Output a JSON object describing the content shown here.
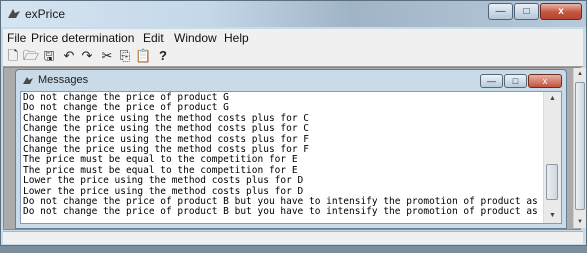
{
  "window": {
    "title": "exPrice"
  },
  "window_controls": {
    "minimize": "—",
    "maximize": "□",
    "close": "x"
  },
  "menu": [
    "File",
    "Price determination",
    "Edit",
    "Window",
    "Help"
  ],
  "toolbar": {
    "new": "🗋",
    "open": "🗁",
    "save": "🖫",
    "undo": "↶",
    "redo": "↷",
    "cut": "✂",
    "copy": "⎘",
    "paste": "📋",
    "help": "?"
  },
  "child": {
    "title": "Messages",
    "controls": {
      "minimize": "—",
      "maximize": "□",
      "close": "x"
    },
    "messages": [
      "Do not change the price of product G",
      "Do not change the price of product G",
      "Change the price using the method costs plus for C",
      "Change the price using the method costs plus for C",
      "Change the price using the method costs plus for F",
      "Change the price using the method costs plus for F",
      "The price must be equal to the competition for E",
      "The price must be equal to the competition for E",
      "Lower the price using the method costs plus for D",
      "Lower the price using the method costs plus for D",
      "Do not change the price of product B but you have to intensify the promotion of product as soon as possible",
      "Do not change the price of product B but you have to intensify the promotion of product as soon as possible"
    ],
    "scroll": {
      "up": "▲",
      "down": "▼"
    }
  },
  "outer_scroll": {
    "up": "▲",
    "down": "▼"
  }
}
